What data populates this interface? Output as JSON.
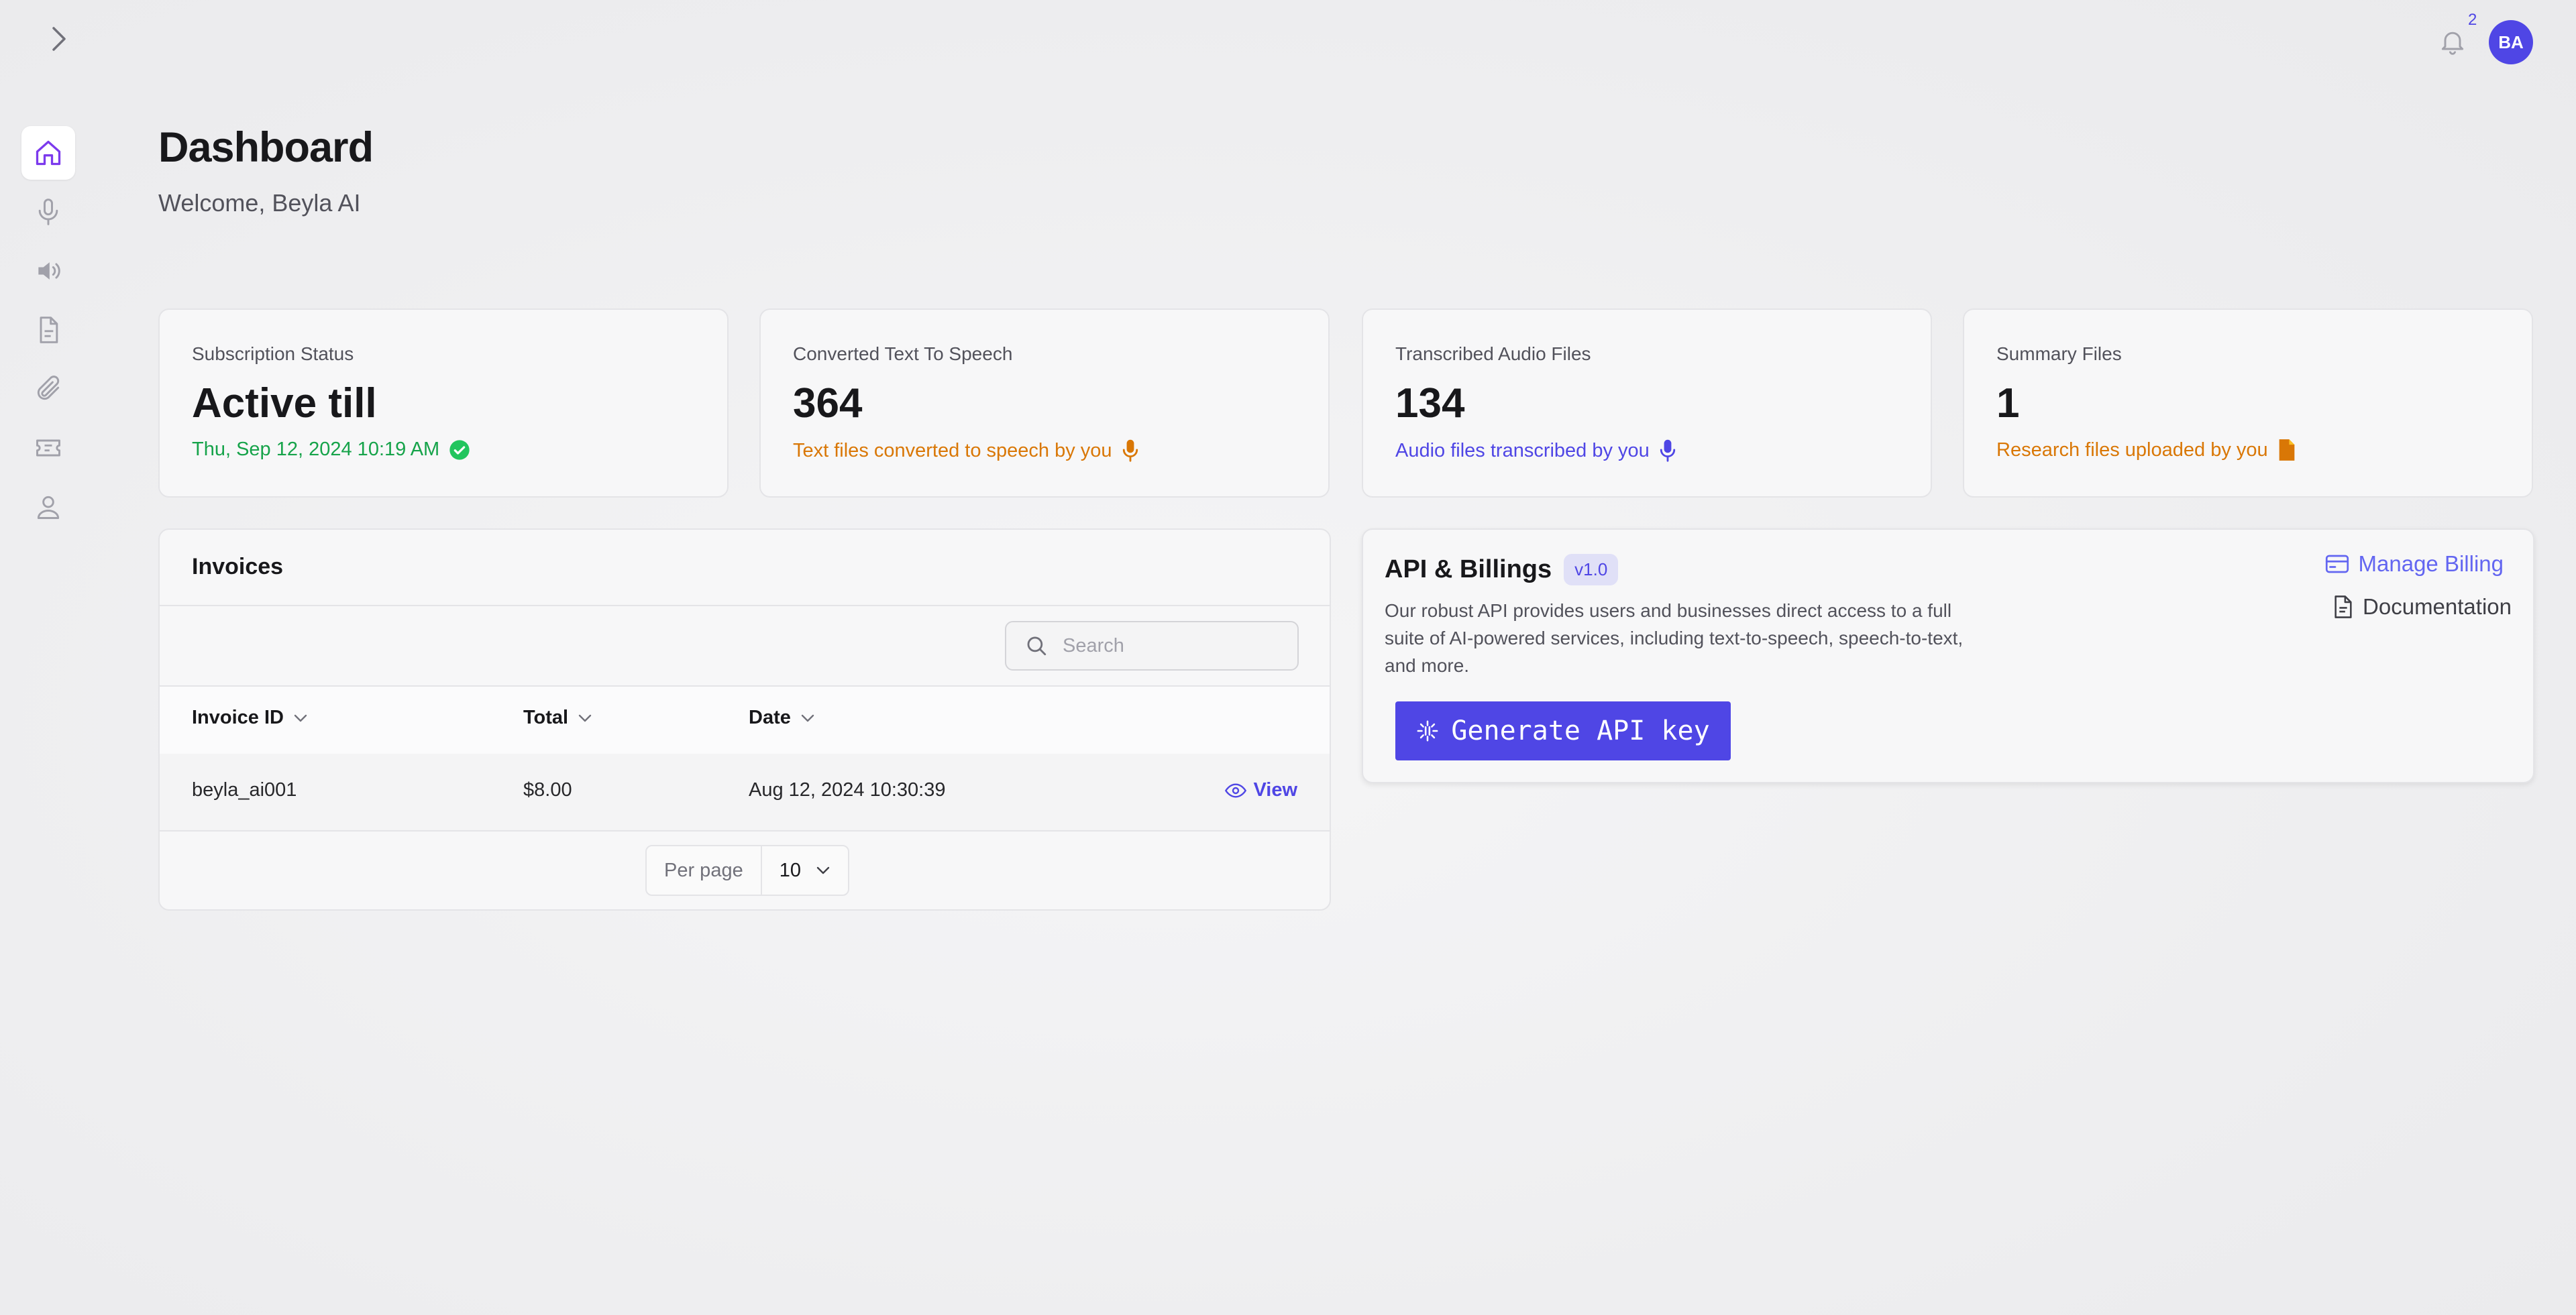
{
  "header": {
    "notification_count": "2",
    "avatar_initials": "BA"
  },
  "page": {
    "title": "Dashboard",
    "subtitle": "Welcome, Beyla AI"
  },
  "stats": [
    {
      "label": "Subscription Status",
      "value": "Active till",
      "note": "Thu, Sep 12, 2024 10:19 AM",
      "note_color": "#16a34a",
      "icon": "check-circle-icon"
    },
    {
      "label": "Converted Text To Speech",
      "value": "364",
      "note": "Text files converted to speech by you",
      "note_color": "#d97706",
      "icon": "microphone-icon"
    },
    {
      "label": "Transcribed Audio Files",
      "value": "134",
      "note": "Audio files transcribed by you",
      "note_color": "#4f46e5",
      "icon": "microphone-icon"
    },
    {
      "label": "Summary Files",
      "value": "1",
      "note": "Research files uploaded by you",
      "note_color": "#d97706",
      "icon": "file-icon"
    }
  ],
  "invoices": {
    "title": "Invoices",
    "search_placeholder": "Search",
    "columns": [
      "Invoice ID",
      "Total",
      "Date"
    ],
    "rows": [
      {
        "id": "beyla_ai001",
        "total": "$8.00",
        "date": "Aug 12, 2024 10:30:39",
        "action": "View"
      }
    ],
    "per_page_label": "Per page",
    "per_page_value": "10"
  },
  "api": {
    "title": "API & Billings",
    "version": "v1.0",
    "description": "Our robust API provides users and businesses direct access to a full suite of AI-powered services, including text-to-speech, speech-to-text, and more.",
    "generate_label": "Generate API key",
    "manage_billing": "Manage Billing",
    "documentation": "Documentation"
  },
  "sidebar": {
    "icons": [
      "home-icon",
      "microphone-icon",
      "speaker-icon",
      "document-icon",
      "paperclip-icon",
      "ticket-icon",
      "user-icon"
    ],
    "active_color": "#7c3aed"
  }
}
